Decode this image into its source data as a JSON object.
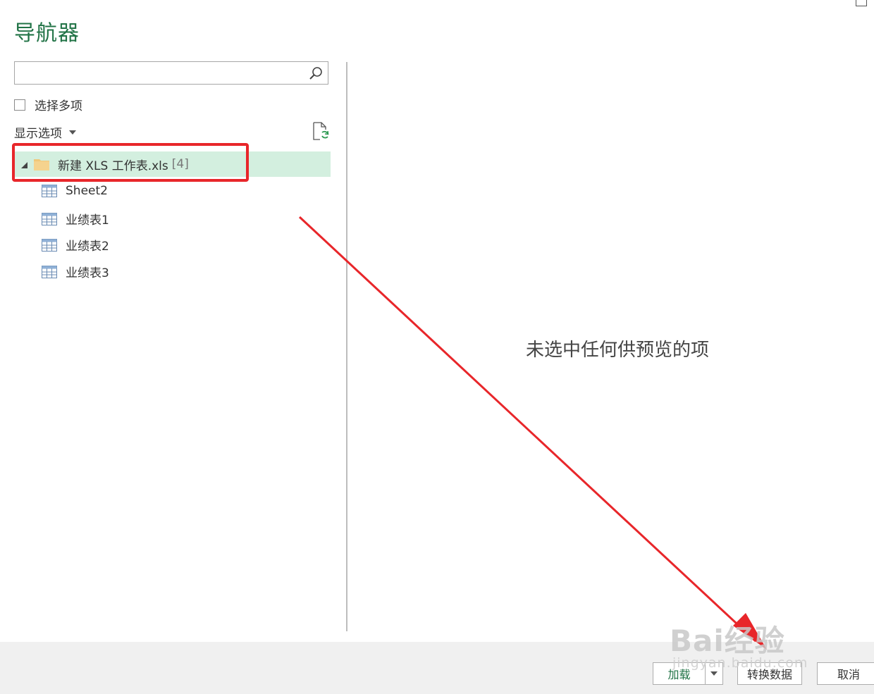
{
  "window": {
    "title": "导航器"
  },
  "search": {
    "placeholder": "",
    "value": ""
  },
  "multi_select": {
    "label": "选择多项",
    "checked": false
  },
  "display_options": {
    "label": "显示选项"
  },
  "tree": {
    "root": {
      "label": "新建 XLS 工作表.xls",
      "count": "[4]",
      "expanded": true
    },
    "items": [
      {
        "label": "Sheet2"
      },
      {
        "label": "业绩表1"
      },
      {
        "label": "业绩表2"
      },
      {
        "label": "业绩表3"
      }
    ]
  },
  "preview": {
    "empty_message": "未选中任何供预览的项"
  },
  "footer": {
    "load_label": "加载",
    "transform_label": "转换数据",
    "cancel_label": "取消"
  },
  "watermark": {
    "brand": "Bai经验",
    "url": "jingyan.baidu.com"
  },
  "colors": {
    "accent": "#217346",
    "selection": "#d3efdf",
    "annotation": "#e8262a"
  }
}
